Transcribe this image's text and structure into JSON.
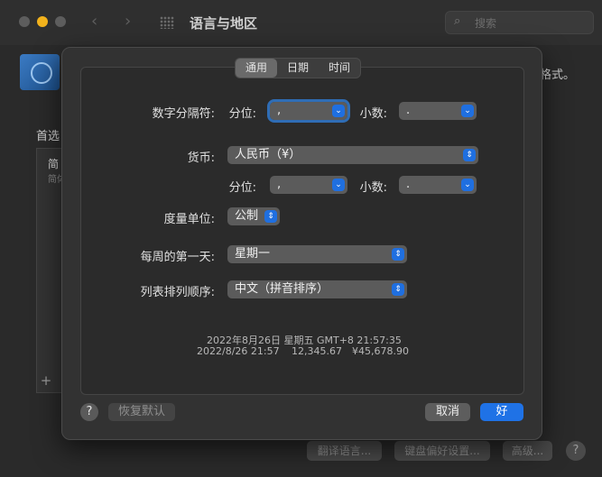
{
  "window": {
    "title": "语言与地区",
    "search_placeholder": "搜索",
    "background_text_tail": "格式。",
    "background_pref_label": "首选",
    "background_list_item": "简",
    "background_list_item_sub": "简体",
    "bottom_buttons": [
      "翻译语言...",
      "键盘偏好设置...",
      "高级..."
    ]
  },
  "tabs": [
    {
      "label": "通用",
      "selected": true
    },
    {
      "label": "日期",
      "selected": false
    },
    {
      "label": "时间",
      "selected": false
    }
  ],
  "number_separators": {
    "label": "数字分隔符:",
    "grouping_label": "分位:",
    "grouping_value": ",",
    "decimal_label": "小数:",
    "decimal_value": "."
  },
  "currency": {
    "label": "货币:",
    "value": "人民币（¥）",
    "grouping_label": "分位:",
    "grouping_value": ",",
    "decimal_label": "小数:",
    "decimal_value": "."
  },
  "measurement": {
    "label": "度量单位:",
    "value": "公制"
  },
  "first_day": {
    "label": "每周的第一天:",
    "value": "星期一"
  },
  "list_sort": {
    "label": "列表排列顺序:",
    "value": "中文（拼音排序）"
  },
  "preview": {
    "long_date": "2022年8月26日 星期五 GMT+8 21:57:35",
    "short_date": "2022/8/26 21:57",
    "number": "12,345.67",
    "currency": "¥45,678.90"
  },
  "footer": {
    "help": "?",
    "restore_defaults": "恢复默认",
    "cancel": "取消",
    "ok": "好"
  },
  "icons": {
    "arrow_single": "chevron-down-icon",
    "arrow_double": "up-down-chevron-icon"
  },
  "colors": {
    "accent": "#1f72e6",
    "sheet": "#323232",
    "popup": "#5b5b5b"
  }
}
